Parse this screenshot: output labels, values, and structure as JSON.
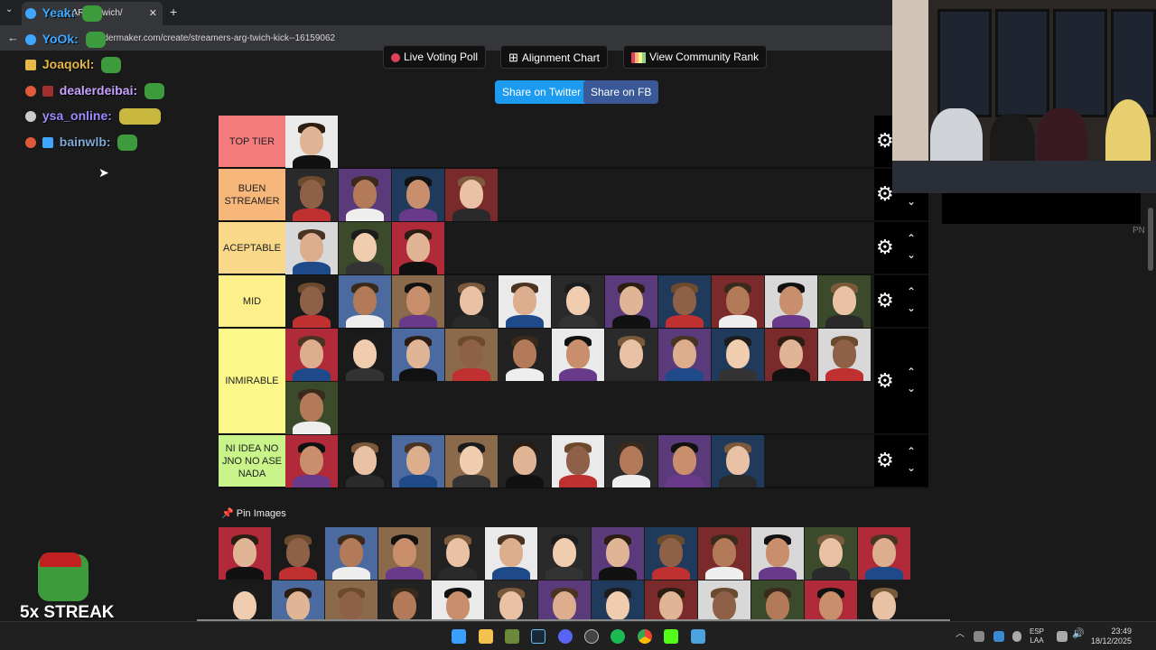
{
  "browser": {
    "tab_title": "...s ARG (Twich/",
    "address": "...dermaker.com/create/streamers-arg-twich-kick--16159062"
  },
  "chat": [
    {
      "user": "Yeak:",
      "color": "#3ea6ff"
    },
    {
      "user": "YoOk:",
      "color": "#3ea6ff"
    },
    {
      "user": "Joaqokl:",
      "color": "#e6b84a"
    },
    {
      "user": "dealerdeibai:",
      "color": "#c8a2ff"
    },
    {
      "user": "ysa_online:",
      "color": "#9b8cff"
    },
    {
      "user": "bainwlb:",
      "color": "#7fa8d6"
    }
  ],
  "toolbar": {
    "live_voting": "Live Voting Poll",
    "alignment": "Alignment Chart",
    "community": "View Community Rank",
    "share_twitter": "Share on Twitter",
    "share_fb": "Share on FB"
  },
  "tiers": [
    {
      "label": "TOP TIER",
      "color": "#f47c7c",
      "count": 1
    },
    {
      "label": "BUEN STREAMER",
      "color": "#f7b77b",
      "count": 4
    },
    {
      "label": "ACEPTABLE",
      "color": "#f9d88a",
      "count": 3
    },
    {
      "label": "MID",
      "color": "#fdf08a",
      "count": 11
    },
    {
      "label": "INMIRABLE",
      "color": "#fdf88a",
      "count": 12
    },
    {
      "label": "NI IDEA NO JNO NO ASE NADA",
      "color": "#c8f48a",
      "count": 9
    }
  ],
  "pin_label": "Pin Images",
  "overlay": {
    "streak": "5x STREAK",
    "side_label": "PN"
  },
  "taskbar": {
    "lang_top": "ESP",
    "lang_bottom": "LAA",
    "time": "23:49",
    "date": "18/12/2025"
  }
}
